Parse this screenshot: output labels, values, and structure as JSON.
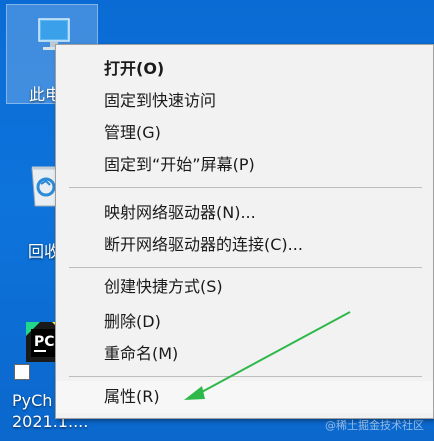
{
  "desktop": {
    "icons": [
      {
        "label": "此电",
        "icon": "this-pc-icon"
      },
      {
        "label": "回收",
        "icon": "recycle-bin-icon"
      },
      {
        "label_line1": "PyCh",
        "label_line2": "2021.1....",
        "icon": "pycharm-icon"
      }
    ]
  },
  "context_menu": {
    "items": [
      {
        "label": "打开(O)",
        "bold": true
      },
      {
        "label": "固定到快速访问"
      },
      {
        "label": "管理(G)"
      },
      {
        "label": "固定到“开始”屏幕(P)"
      },
      {
        "label": "映射网络驱动器(N)..."
      },
      {
        "label": "断开网络驱动器的连接(C)..."
      },
      {
        "label": "创建快捷方式(S)"
      },
      {
        "label": "删除(D)"
      },
      {
        "label": "重命名(M)"
      },
      {
        "label": "属性(R)"
      }
    ]
  },
  "annotation": {
    "arrow_color": "#2fb84a",
    "points_to": "属性(R)"
  },
  "watermark": "@稀土掘金技术社区",
  "colors": {
    "desktop_blue": "#0a6fd3",
    "menu_bg": "#f2f2f2",
    "separator": "#bdbdbd"
  }
}
